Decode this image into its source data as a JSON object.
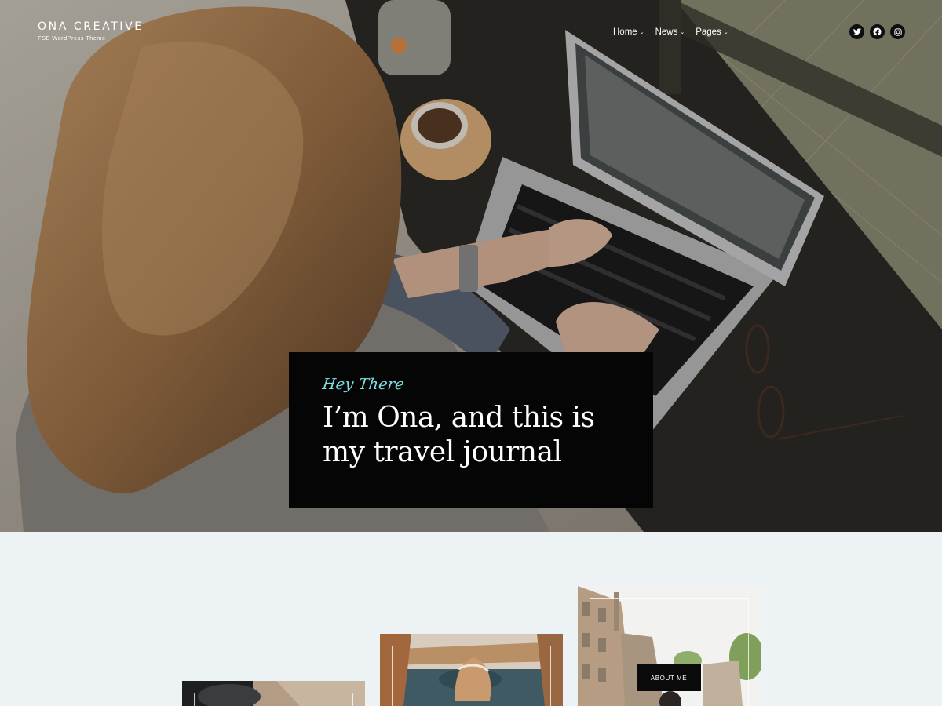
{
  "site": {
    "title": "ONA CREATIVE",
    "tagline": "FSE WordPress Theme"
  },
  "nav": [
    {
      "label": "Home",
      "icon": "chevron-down-icon"
    },
    {
      "label": "News",
      "icon": "chevron-down-icon"
    },
    {
      "label": "Pages",
      "icon": "chevron-down-icon"
    }
  ],
  "social": [
    {
      "name": "twitter",
      "icon": "twitter-icon"
    },
    {
      "name": "facebook",
      "icon": "facebook-icon"
    },
    {
      "name": "instagram",
      "icon": "instagram-icon"
    }
  ],
  "hero": {
    "kicker": "Hey There",
    "heading": "I’m Ona, and this is my travel journal",
    "image": "woman-typing-on-laptop-photo"
  },
  "about": {
    "button_label": "ABOUT ME",
    "images": [
      "interior-photo",
      "canyon-lake-photo",
      "street-buildings-photo"
    ]
  },
  "colors": {
    "accent": "#7fe0e3",
    "card_bg": "#050505",
    "section_bg": "#edf3f5"
  }
}
